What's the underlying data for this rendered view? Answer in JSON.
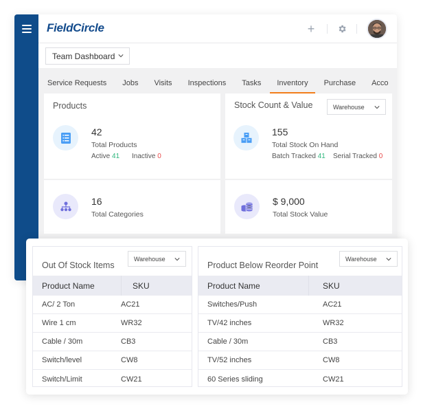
{
  "app": {
    "logo": "FieldCircle",
    "dashboard_select": "Team Dashboard",
    "accent_color": "#f27e1b",
    "sidebar_color": "#0f4c8a"
  },
  "header": {
    "icons": [
      "menu-icon",
      "plus-icon",
      "gear-icon",
      "avatar"
    ]
  },
  "tabs": [
    {
      "label": "Service Requests",
      "active": false
    },
    {
      "label": "Jobs",
      "active": false
    },
    {
      "label": "Visits",
      "active": false
    },
    {
      "label": "Inspections",
      "active": false
    },
    {
      "label": "Tasks",
      "active": false
    },
    {
      "label": "Inventory",
      "active": true
    },
    {
      "label": "Purchase",
      "active": false
    },
    {
      "label": "Acco",
      "active": false
    }
  ],
  "products_card": {
    "title": "Products",
    "total_value": "42",
    "total_label": "Total Products",
    "active_label": "Active",
    "active_value": "41",
    "inactive_label": "Inactive",
    "inactive_value": "0",
    "categories_value": "16",
    "categories_label": "Total Categories"
  },
  "stock_card": {
    "title": "Stock Count & Value",
    "filter": "Warehouse",
    "on_hand_value": "155",
    "on_hand_label": "Total Stock On Hand",
    "batch_label": "Batch Tracked",
    "batch_value": "41",
    "serial_label": "Serial Tracked",
    "serial_value": "0",
    "stock_value": "$ 9,000",
    "stock_value_label": "Total Stock Value"
  },
  "out_of_stock": {
    "title": "Out Of Stock Items",
    "filter": "Warehouse",
    "columns": [
      "Product Name",
      "SKU"
    ],
    "rows": [
      [
        "AC/ 2 Ton",
        "AC21"
      ],
      [
        "Wire 1 cm",
        "WR32"
      ],
      [
        "Cable / 30m",
        "CB3"
      ],
      [
        "Switch/level",
        "CW8"
      ],
      [
        "Switch/Limit",
        "CW21"
      ]
    ]
  },
  "below_reorder": {
    "title": "Product Below Reorder Point",
    "filter": "Warehouse",
    "columns": [
      "Product Name",
      "SKU"
    ],
    "rows": [
      [
        "Switches/Push",
        "AC21"
      ],
      [
        "TV/42 inches",
        "WR32"
      ],
      [
        "Cable / 30m",
        "CB3"
      ],
      [
        "TV/52 inches",
        "CW8"
      ],
      [
        "60 Series sliding",
        "CW21"
      ]
    ]
  }
}
